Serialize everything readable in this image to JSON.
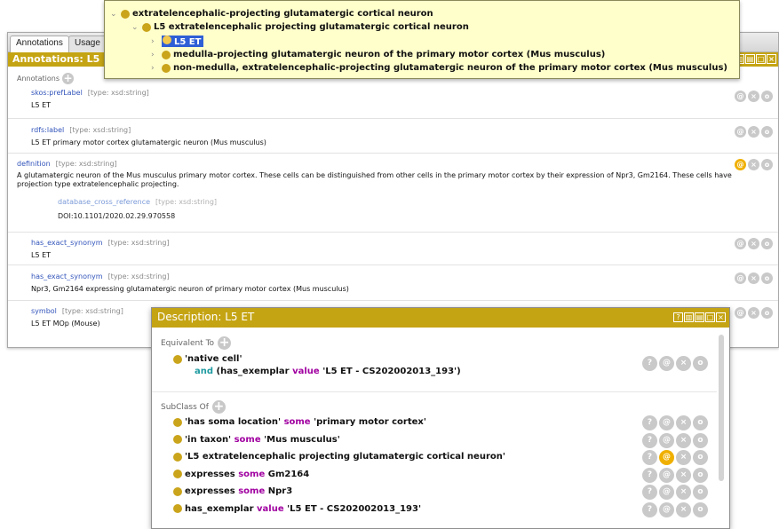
{
  "colors": {
    "accent": "#c5a414",
    "selection": "#2f5fd6",
    "tooltip_bg": "#ffffcc",
    "keyword_purple": "#a000a0",
    "keyword_teal": "#1e9aa0",
    "annotation_button_active": "#f0b000"
  },
  "annotations_window": {
    "tabs": [
      "Annotations",
      "Usage"
    ],
    "header_title": "Annotations: L5 ET",
    "section_label": "Annotations",
    "rows": [
      {
        "property": "skos:prefLabel",
        "type": "[type: xsd:string]",
        "value": "L5 ET"
      },
      {
        "property": "rdfs:label",
        "type": "[type: xsd:string]",
        "value": "L5 ET primary motor cortex glutamatergic neuron (Mus musculus)"
      },
      {
        "property": "definition",
        "type": "[type: xsd:string]",
        "value": "A glutamatergic neuron of the Mus musculus primary motor cortex. These cells can be distinguished from other cells in the primary motor cortex by their expression of Npr3, Gm2164. These cells have projection type extratelencephalic projecting.",
        "nested": {
          "property": "database_cross_reference",
          "type": "[type: xsd:string]",
          "value": "DOI:10.1101/2020.02.29.970558"
        }
      },
      {
        "property": "has_exact_synonym",
        "type": "[type: xsd:string]",
        "value": "L5 ET"
      },
      {
        "property": "has_exact_synonym",
        "type": "[type: xsd:string]",
        "value": "Npr3, Gm2164 expressing glutamatergic neuron of primary motor cortex (Mus musculus)"
      },
      {
        "property": "symbol",
        "type": "[type: xsd:string]",
        "value": "L5 ET MOp (Mouse)"
      }
    ],
    "row_buttons": [
      "@",
      "×",
      "o"
    ]
  },
  "hierarchy_popup": {
    "items": [
      {
        "label": "extratelencephalic-projecting glutamatergic cortical neuron"
      },
      {
        "label": "L5 extratelencephalic projecting glutamatergic cortical neuron"
      },
      {
        "label": "L5 ET"
      },
      {
        "label": "medulla-projecting glutamatergic neuron of the primary motor cortex (Mus musculus)"
      },
      {
        "label": "non-medulla, extratelencephalic-projecting glutamatergic neuron of the primary motor cortex (Mus musculus)"
      }
    ]
  },
  "description_window": {
    "header_title": "Description: L5 ET",
    "equivalent_label": "Equivalent To",
    "equivalent": {
      "line1": "'native cell'",
      "line2_and": "and",
      "line2_prop": "(has_exemplar",
      "line2_kw": "value",
      "line2_value": "'L5 ET - CS202002013_193')"
    },
    "subclass_label": "SubClass Of",
    "subclass_rows": [
      {
        "prop": "'has soma location'",
        "kw": "some",
        "obj": "'primary motor cortex'"
      },
      {
        "prop": "'in taxon'",
        "kw": "some",
        "obj": "'Mus musculus'"
      },
      {
        "prop": "'L5 extratelencephalic projecting glutamatergic cortical neuron'",
        "kw": "",
        "obj": ""
      },
      {
        "prop": "expresses",
        "kw": "some",
        "obj": "Gm2164"
      },
      {
        "prop": "expresses",
        "kw": "some",
        "obj": "Npr3"
      },
      {
        "prop": "has_exemplar",
        "kw": "value",
        "obj": "'L5 ET - CS202002013_193'"
      }
    ],
    "row_buttons": [
      "?",
      "@",
      "×",
      "o"
    ]
  }
}
